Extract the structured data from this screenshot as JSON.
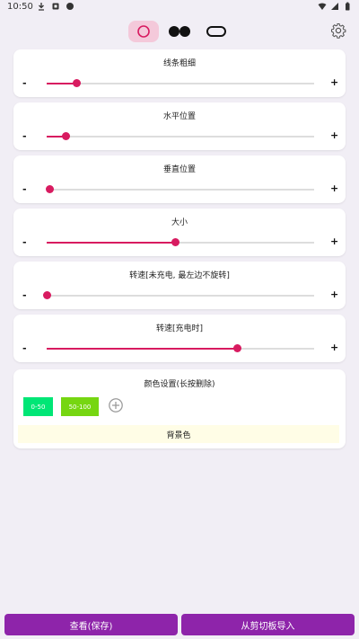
{
  "statusbar": {
    "time": "10:50",
    "left_icons": [
      "download-icon",
      "sim-icon",
      "dot-icon"
    ],
    "right_icons": [
      "wifi-icon",
      "signal-icon",
      "battery-icon"
    ]
  },
  "topbar": {
    "tabs": [
      "circle-shape-icon",
      "dots-shape-icon",
      "pill-shape-icon"
    ],
    "selected_tab": 0,
    "settings_icon": "gear-icon"
  },
  "sliders": [
    {
      "title": "线条粗细",
      "value_fraction": 0.11,
      "minus": "-",
      "plus": "+"
    },
    {
      "title": "水平位置",
      "value_fraction": 0.07,
      "minus": "-",
      "plus": "+"
    },
    {
      "title": "垂直位置",
      "value_fraction": 0.01,
      "minus": "-",
      "plus": "+"
    },
    {
      "title": "大小",
      "value_fraction": 0.48,
      "minus": "-",
      "plus": "+"
    },
    {
      "title": "转速[未充电, 最左边不旋转]",
      "value_fraction": 0.0,
      "minus": "-",
      "plus": "+"
    },
    {
      "title": "转速[充电时]",
      "value_fraction": 0.71,
      "minus": "-",
      "plus": "+"
    }
  ],
  "color_settings": {
    "title": "颜色设置(长按删除)",
    "chips": [
      {
        "label": "0-50",
        "color": "#00e676"
      },
      {
        "label": "50-100",
        "color": "#76d611"
      }
    ],
    "add_icon": "add-circle-icon",
    "background_label": "背景色"
  },
  "bottom": {
    "view_save": "查看(保存)",
    "import_clipboard": "从剪切板导入"
  },
  "colors": {
    "accent": "#d81b60",
    "button": "#8e24aa",
    "background": "#f1eef5"
  }
}
